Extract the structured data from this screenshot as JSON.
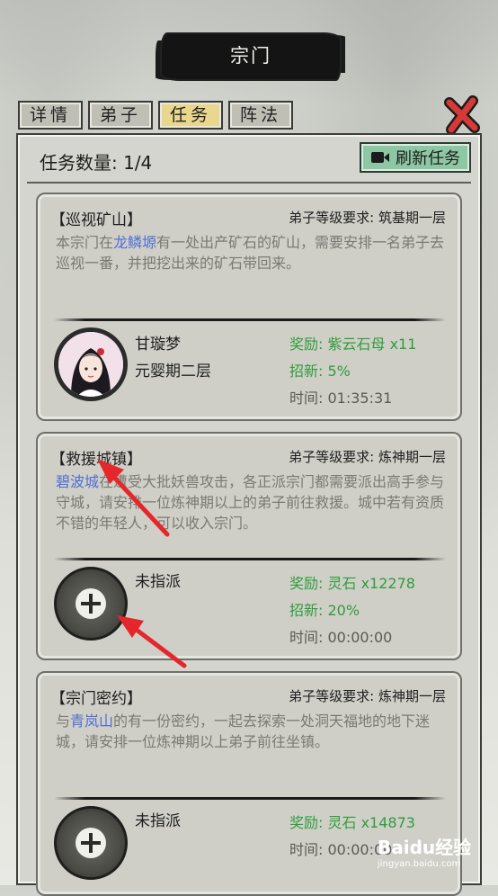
{
  "header": {
    "title": "宗门"
  },
  "tabs": [
    {
      "label": "详情"
    },
    {
      "label": "弟子"
    },
    {
      "label": "任务",
      "active": true
    },
    {
      "label": "阵法"
    }
  ],
  "task_panel": {
    "count_label": "任务数量: 1/4",
    "refresh_button": "刷新任务"
  },
  "tasks": [
    {
      "title": "【巡视矿山】",
      "requirement": "弟子等级要求: 筑基期一层",
      "desc_prefix": "本宗门在",
      "place": "龙鳞塬",
      "desc_suffix": "有一处出产矿石的矿山，需要安排一名弟子去巡视一番，并把挖出来的矿石带回来。",
      "disciple_name": "甘璇梦",
      "disciple_level": "元婴期二层",
      "reward": "奖励: 紫云石母 x11",
      "recruit": "招新: 5%",
      "time": "时间: 01:35:31"
    },
    {
      "title": "【救援城镇】",
      "requirement": "弟子等级要求: 炼神期一层",
      "place": "碧波城",
      "desc_suffix": "在遭受大批妖兽攻击，各正派宗门都需要派出高手参与守城，请安排一位炼神期以上的弟子前往救援。城中若有资质不错的年轻人，可以收入宗门。",
      "disciple_name": "未指派",
      "reward": "奖励: 灵石 x12278",
      "recruit": "招新: 20%",
      "time": "时间: 00:00:00"
    },
    {
      "title": "【宗门密约】",
      "requirement": "弟子等级要求: 炼神期一层",
      "desc_prefix": "与",
      "place": "青岚山",
      "desc_suffix": "的有一份密约，一起去探索一处洞天福地的地下迷城，请安排一位炼神期以上弟子前往坐镇。",
      "disciple_name": "未指派",
      "reward": "奖励: 灵石 x14873",
      "time": "时间: 00:00:00"
    }
  ],
  "watermark": {
    "text": "Baidu经验",
    "sub": "jingyan.baidu.com"
  },
  "colors": {
    "reward_green": "#2f9d3a",
    "place_blue": "#4f6fd4",
    "tab_active": "#e9d78e",
    "refresh_bg": "#8ec7a3",
    "arrow_red": "#e5262b"
  }
}
